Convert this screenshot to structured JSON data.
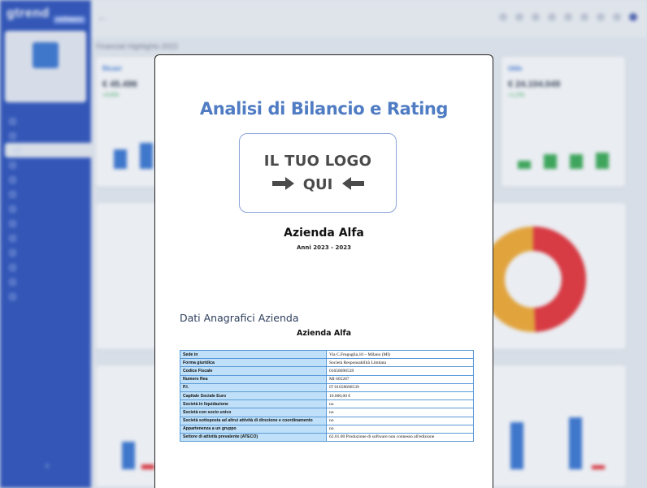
{
  "background": {
    "brand": "gtrend",
    "brand_badge": "software",
    "sidebar_menu": [
      "",
      "",
      "",
      "",
      "",
      "",
      "",
      "",
      "",
      "",
      "",
      "",
      "",
      "",
      ""
    ],
    "page_header": "Financial Highlights 2023",
    "cards": [
      {
        "title": "Ricavi",
        "value": "€ 45.496",
        "pct": "+5,6%"
      },
      {
        "title": "Utile",
        "value": "€ 24.104.049",
        "pct": "+1,2%"
      }
    ]
  },
  "document": {
    "title": "Analisi di Bilancio e Rating",
    "logo_line1": "IL TUO LOGO",
    "logo_line2": "QUI",
    "company": "Azienda Alfa",
    "years": "Anni 2023 - 2023",
    "section_heading": "Dati Anagrafici Azienda",
    "company_repeat": "Azienda Alfa",
    "rows": [
      {
        "k": "Sede in",
        "v": "Via C.Freguglia,10 – Milano (MI)"
      },
      {
        "k": "Forma giuridica",
        "v": "Società Responsabilità Limitata"
      },
      {
        "k": "Codice Fiscale",
        "v": "01658690539"
      },
      {
        "k": "Numero Rea",
        "v": "MI 605287"
      },
      {
        "k": "P.I.",
        "v": "IT 01658690539"
      },
      {
        "k": "Capitale Sociale Euro",
        "v": "10.000,00 €"
      },
      {
        "k": "Società in liquidazione",
        "v": "no"
      },
      {
        "k": "Società con socio unico",
        "v": "no"
      },
      {
        "k": "Società sottoposta ad altrui attività di direzione e coordinamento",
        "v": "no"
      },
      {
        "k": "Appartenenza a un gruppo",
        "v": "no"
      },
      {
        "k": "Settore di attività prevalente (ATECO)",
        "v": "62.01.00 Produzione di software non connesso all'edizione"
      }
    ]
  }
}
